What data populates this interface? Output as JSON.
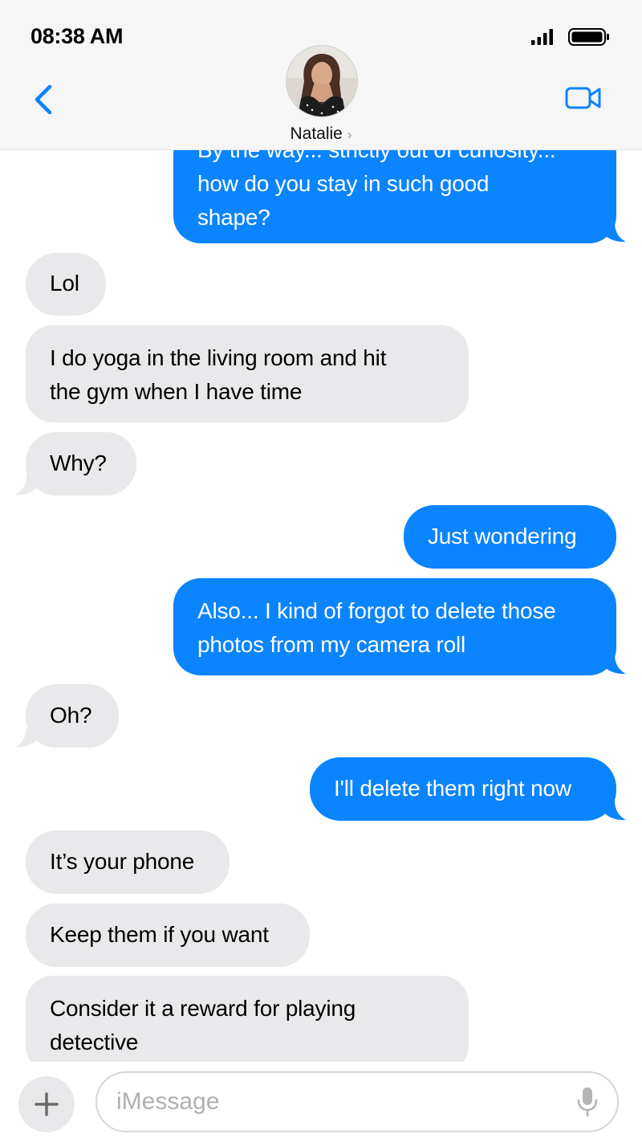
{
  "status_bar": {
    "time": "08:38 AM"
  },
  "header": {
    "contact_name": "Natalie",
    "name_chevron": "›",
    "back_icon": "chevron-left-icon",
    "video_icon": "video-camera-icon"
  },
  "colors": {
    "accent": "#0a84ff",
    "incoming_bubble": "#e9e9eb",
    "header_bg": "#f6f6f6"
  },
  "messages": [
    {
      "from": "me",
      "lines": [
        "By the way... strictly out of curiosity...",
        "how do you stay in such good",
        "shape?"
      ]
    },
    {
      "from": "them",
      "lines": [
        "Lol"
      ]
    },
    {
      "from": "them",
      "lines": [
        "I do yoga in the living room and hit",
        "the gym when I have time"
      ]
    },
    {
      "from": "them",
      "lines": [
        "Why?"
      ]
    },
    {
      "from": "me",
      "lines": [
        "Just wondering"
      ]
    },
    {
      "from": "me",
      "lines": [
        "Also... I kind of forgot to delete those",
        "photos from my camera roll"
      ]
    },
    {
      "from": "them",
      "lines": [
        "Oh?"
      ]
    },
    {
      "from": "me",
      "lines": [
        "I'll delete them right now"
      ]
    },
    {
      "from": "them",
      "lines": [
        "It’s your phone"
      ]
    },
    {
      "from": "them",
      "lines": [
        "Keep them if you want"
      ]
    },
    {
      "from": "them",
      "lines": [
        "Consider it a reward for playing",
        "detective"
      ]
    }
  ],
  "composer": {
    "placeholder": "iMessage",
    "value": "",
    "plus_icon": "plus-icon",
    "mic_icon": "microphone-icon"
  }
}
